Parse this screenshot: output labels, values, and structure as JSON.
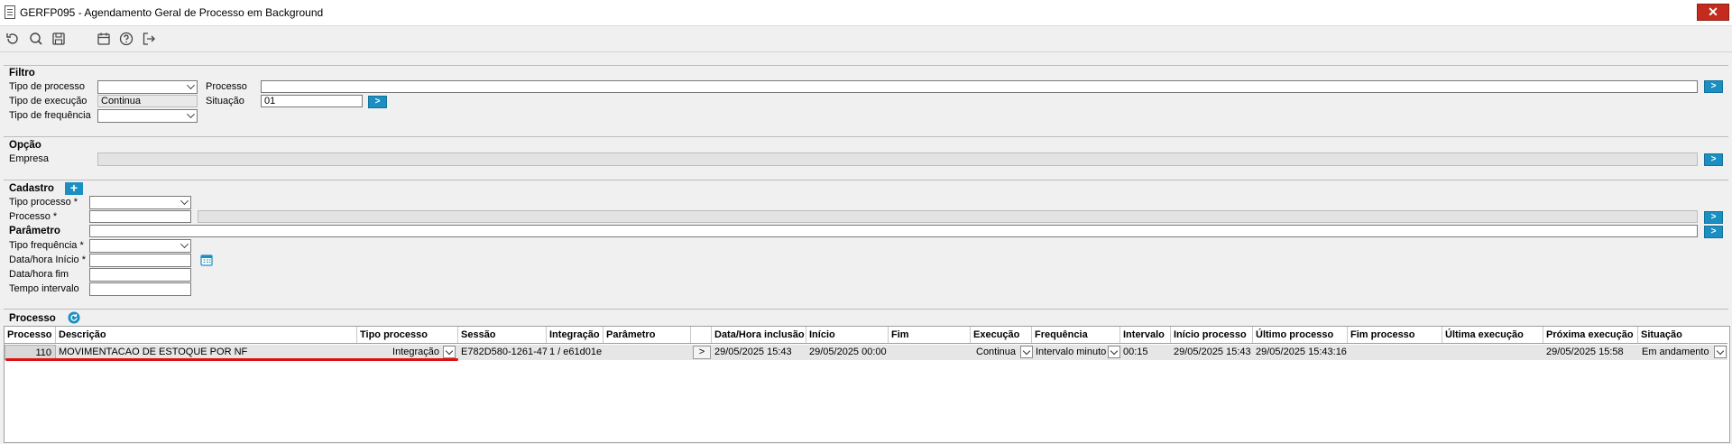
{
  "window": {
    "title": "GERFP095 - Agendamento Geral de Processo em Background",
    "close_label": "✕"
  },
  "toolbar": {
    "icons": [
      "undo-icon",
      "search-icon",
      "save-icon",
      "calendar-icon",
      "help-icon",
      "exit-icon"
    ]
  },
  "filtro": {
    "title": "Filtro",
    "tipo_processo_label": "Tipo de processo",
    "tipo_execucao_label": "Tipo de execução",
    "tipo_execucao_value": "Continua",
    "tipo_frequencia_label": "Tipo de frequência",
    "processo_label": "Processo",
    "processo_value": "",
    "situacao_label": "Situação",
    "situacao_value": "01"
  },
  "opcao": {
    "title": "Opção",
    "empresa_label": "Empresa"
  },
  "cadastro": {
    "title": "Cadastro",
    "add_label": "+",
    "tipo_processo_label": "Tipo processo *",
    "processo_label": "Processo *",
    "parametro_label": "Parâmetro",
    "tipo_frequencia_label": "Tipo frequência *",
    "data_inicio_label": "Data/hora Início *",
    "data_fim_label": "Data/hora fim",
    "tempo_intervalo_label": "Tempo intervalo"
  },
  "processo_section": {
    "title": "Processo"
  },
  "grid": {
    "columns": [
      "Processo",
      "Descrição",
      "Tipo processo",
      "Sessão",
      "Integração",
      "Parâmetro",
      "",
      "Data/Hora inclusão",
      "Início",
      "Fim",
      "Execução",
      "Frequência",
      "Intervalo",
      "Início processo",
      "Último processo",
      "Fim processo",
      "Última execução",
      "Próxima execução",
      "Situação"
    ],
    "row": {
      "processo": "110",
      "descricao": "MOVIMENTACAO DE ESTOQUE POR NF",
      "tipo_processo": "Integração",
      "sessao": "E782D580-1261-47.",
      "integracao": "1 / e61d01e",
      "parametro": "",
      "btn": ">",
      "data_inclusao": "29/05/2025 15:43",
      "inicio": "29/05/2025 00:00",
      "fim": "",
      "execucao": "Continua",
      "frequencia": "Intervalo minuto",
      "intervalo": "00:15",
      "inicio_processo": "29/05/2025 15:43",
      "ultimo_processo": "29/05/2025 15:43:16",
      "fim_processo": "",
      "ultima_execucao": "",
      "proxima_execucao": "29/05/2025 15:58",
      "situacao": "Em andamento"
    }
  }
}
